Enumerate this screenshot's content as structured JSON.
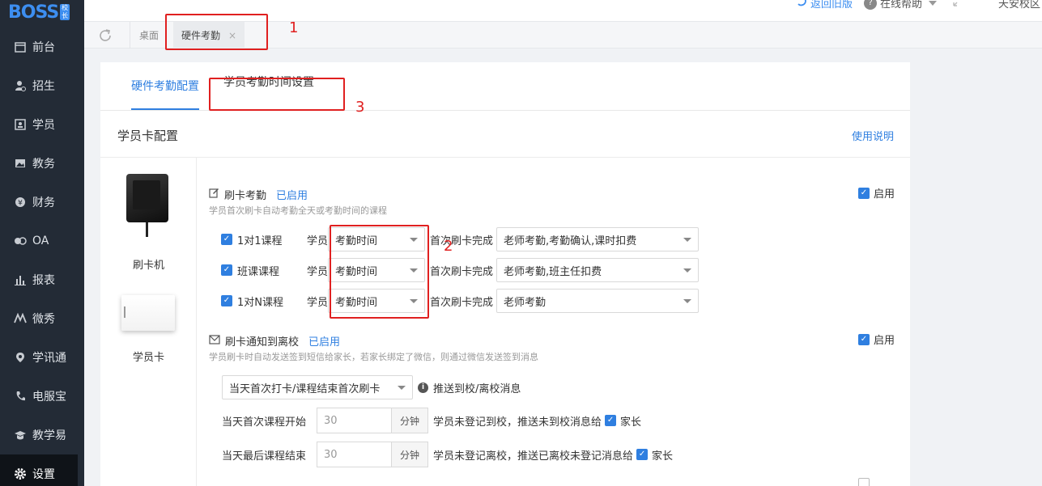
{
  "logo": {
    "text": "BOSS",
    "badge": "校长"
  },
  "sidebar": {
    "items": [
      {
        "label": "前台",
        "icon": "calendar-icon"
      },
      {
        "label": "招生",
        "icon": "user-add-icon"
      },
      {
        "label": "学员",
        "icon": "id-card-icon"
      },
      {
        "label": "教务",
        "icon": "image-icon"
      },
      {
        "label": "财务",
        "icon": "yen-icon"
      },
      {
        "label": "OA",
        "icon": "oa-icon"
      },
      {
        "label": "报表",
        "icon": "bar-chart-icon"
      },
      {
        "label": "微秀",
        "icon": "wei-icon"
      },
      {
        "label": "学讯通",
        "icon": "location-icon"
      },
      {
        "label": "电服宝",
        "icon": "phone-icon"
      },
      {
        "label": "教学易",
        "icon": "graduation-icon"
      },
      {
        "label": "设置",
        "icon": "gear-icon"
      }
    ]
  },
  "topbar": {
    "return_old": "返回旧版",
    "online_help": "在线帮助",
    "campus": "天安校区"
  },
  "tabs": {
    "desk": "桌面",
    "active": "硬件考勤",
    "close": "×"
  },
  "annotations": {
    "n1": "1",
    "n2": "2",
    "n3": "3"
  },
  "config_tabs": {
    "hardware": "硬件考勤配置",
    "student_time": "学员考勤时间设置"
  },
  "section": {
    "title": "学员卡配置",
    "help_link": "使用说明"
  },
  "devices": {
    "reader": "刷卡机",
    "card": "学员卡"
  },
  "swipe_attendance": {
    "title": "刷卡考勤",
    "status": "已启用",
    "desc": "学员首次刷卡自动考勤全天或考勤时间的课程",
    "enable_label": "启用",
    "rows": [
      {
        "course": "1对1课程",
        "prefix": "学员",
        "time_select": "考勤时间",
        "first_label": "首次刷卡完成",
        "action_select": "老师考勤,考勤确认,课时扣费"
      },
      {
        "course": "班课课程",
        "prefix": "学员",
        "time_select": "考勤时间",
        "first_label": "首次刷卡完成",
        "action_select": "老师考勤,班主任扣费"
      },
      {
        "course": "1对N课程",
        "prefix": "学员",
        "time_select": "考勤时间",
        "first_label": "首次刷卡完成",
        "action_select": "老师考勤"
      }
    ]
  },
  "notify": {
    "title": "刷卡通知到离校",
    "status": "已启用",
    "desc": "学员刷卡时自动发送签到短信给家长，若家长绑定了微信，则通过微信发送签到消息",
    "enable_label": "启用",
    "trigger_select": "当天首次打卡/课程结束首次刷卡",
    "push_label": "推送到校/离校消息",
    "start_label": "当天首次课程开始",
    "start_value": "30",
    "start_unit": "分钟",
    "start_msg": "学员未登记到校，推送未到校消息给",
    "start_target": "家长",
    "end_label": "当天最后课程结束",
    "end_value": "30",
    "end_unit": "分钟",
    "end_msg": "学员未登记离校，推送已离校未登记消息给",
    "end_target": "家长"
  },
  "colors": {
    "accent": "#2f7fe0",
    "sidebar": "#232b36",
    "annotation": "#e02020"
  }
}
